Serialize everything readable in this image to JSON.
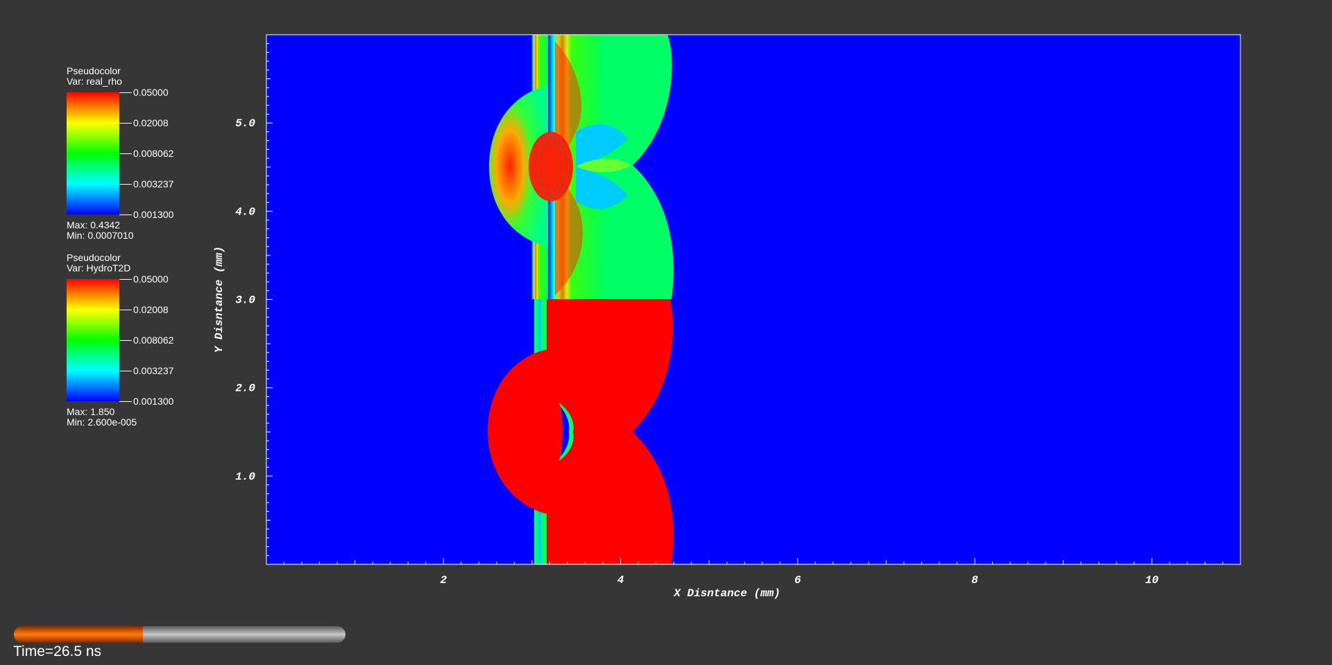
{
  "chart_data": {
    "type": "heatmap",
    "xlabel": "X Disntance (mm)",
    "ylabel": "Y Disntance (mm)",
    "xlim": [
      0,
      11
    ],
    "ylim": [
      0,
      6
    ],
    "x_ticks": [
      {
        "value": 2,
        "label": "2"
      },
      {
        "value": 4,
        "label": "4"
      },
      {
        "value": 6,
        "label": "6"
      },
      {
        "value": 8,
        "label": "8"
      },
      {
        "value": 10,
        "label": "10"
      }
    ],
    "y_ticks": [
      {
        "value": 1,
        "label": "1.0"
      },
      {
        "value": 2,
        "label": "2.0"
      },
      {
        "value": 3,
        "label": "3.0"
      },
      {
        "value": 4,
        "label": "4.0"
      },
      {
        "value": 5,
        "label": "5.0"
      }
    ],
    "x_minor_step": 0.2,
    "y_minor_step": 0.1,
    "split_y": 3.0,
    "legends": [
      {
        "title": "Pseudocolor",
        "var": "Var: real_rho",
        "ticks": [
          "0.05000",
          "0.02008",
          "0.008062",
          "0.003237",
          "0.001300"
        ],
        "max": "Max:  0.4342",
        "min": "Min:  0.0007010"
      },
      {
        "title": "Pseudocolor",
        "var": "Var: HydroT2D",
        "ticks": [
          "0.05000",
          "0.02008",
          "0.008062",
          "0.003237",
          "0.001300"
        ],
        "max": "Max:  1.850",
        "min": "Min:  2.600e-005"
      }
    ],
    "colors": {
      "background": "#0000ff",
      "high": "#ff0000",
      "mid": "#00ff00",
      "axis": "#ffffff"
    }
  },
  "time": {
    "label": "Time=26.5 ns",
    "progress": 0.39
  }
}
